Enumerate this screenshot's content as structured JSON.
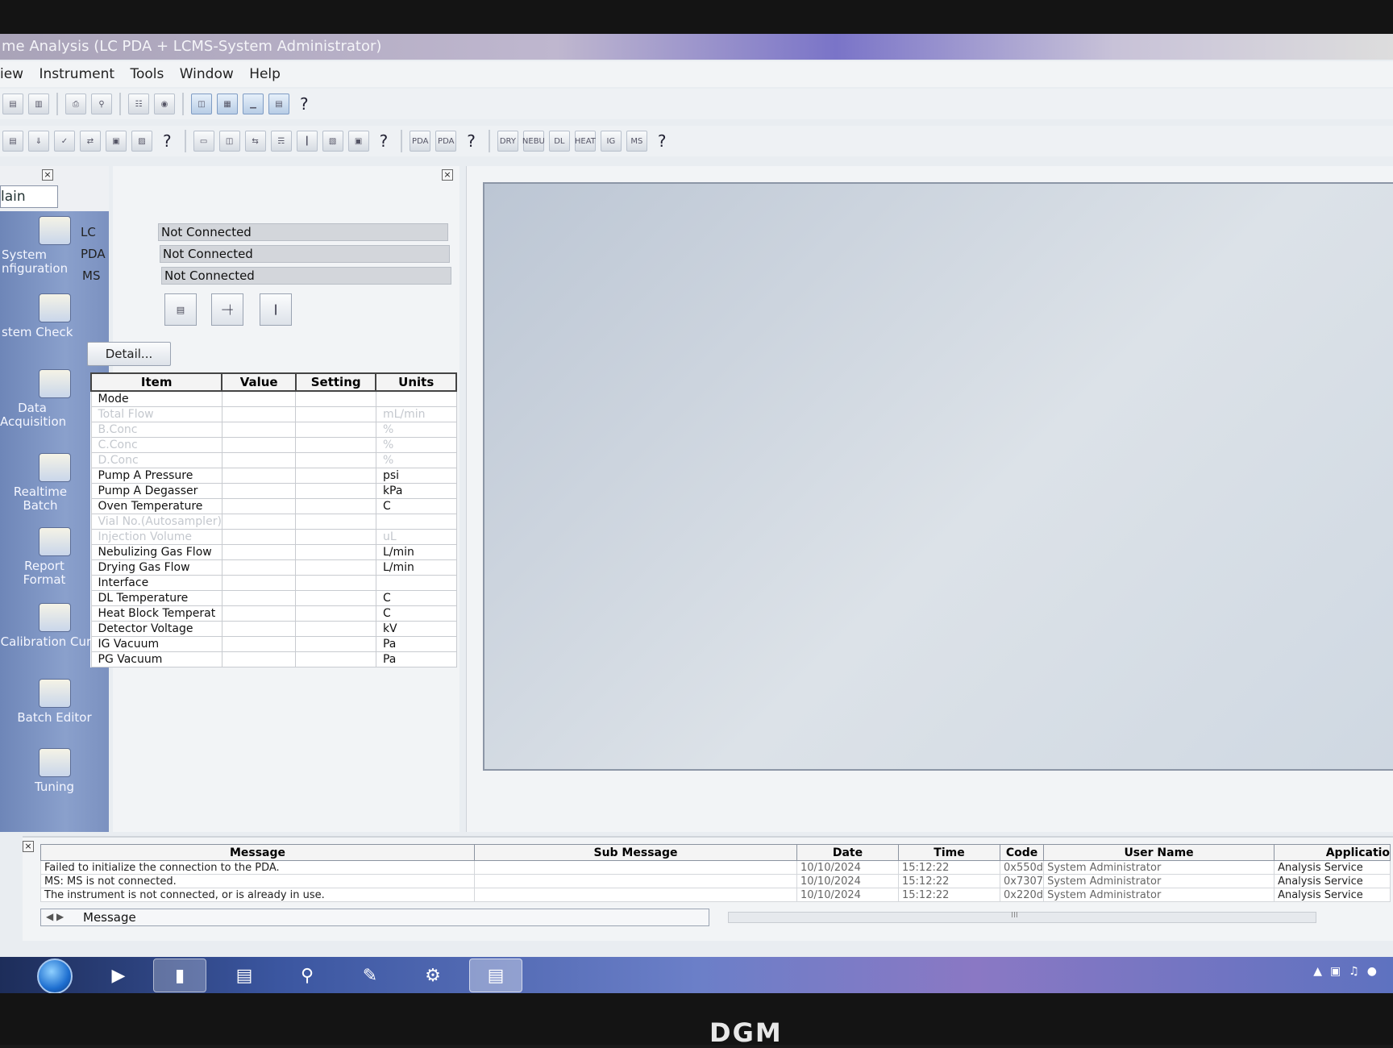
{
  "window": {
    "title": "me Analysis (LC PDA + LCMS-System Administrator)"
  },
  "menu": [
    "iew",
    "Instrument",
    "Tools",
    "Window",
    "Help"
  ],
  "toolbar2_labels": [
    "PDA",
    "PDA",
    "DRY",
    "NEBU",
    "DL",
    "HEAT",
    "IG",
    "MS"
  ],
  "help_glyph": "?",
  "nav": {
    "tab": "lain",
    "items": [
      {
        "label": "System\nnfiguration",
        "icon": "system-configuration-icon"
      },
      {
        "label": "stem Check",
        "icon": "system-check-icon"
      },
      {
        "label": "Data\nAcquisition",
        "icon": "flask-icon"
      },
      {
        "label": "Realtime Batch",
        "icon": "realtime-batch-icon"
      },
      {
        "label": "Report\nFormat",
        "icon": "report-format-icon"
      },
      {
        "label": "Calibration Curve",
        "icon": "calibration-curve-icon"
      },
      {
        "label": "Batch Editor",
        "icon": "batch-editor-icon"
      },
      {
        "label": "Tuning",
        "icon": "tuning-icon"
      }
    ]
  },
  "status": {
    "rows": [
      {
        "label": "LC",
        "value": "Not Connected"
      },
      {
        "label": "PDA",
        "value": "Not Connected"
      },
      {
        "label": "MS",
        "value": "Not Connected"
      }
    ],
    "detail_button": "Detail..."
  },
  "grid": {
    "headers": [
      "Item",
      "Value",
      "Setting",
      "Units"
    ],
    "rows": [
      {
        "item": "Mode",
        "units": "",
        "dim": false
      },
      {
        "item": "Total Flow",
        "units": "mL/min",
        "dim": true
      },
      {
        "item": "B.Conc",
        "units": "%",
        "dim": true
      },
      {
        "item": "C.Conc",
        "units": "%",
        "dim": true
      },
      {
        "item": "D.Conc",
        "units": "%",
        "dim": true
      },
      {
        "item": "Pump A Pressure",
        "units": "psi",
        "dim": false
      },
      {
        "item": "Pump A Degasser",
        "units": "kPa",
        "dim": false
      },
      {
        "item": "Oven Temperature",
        "units": "C",
        "dim": false
      },
      {
        "item": "Vial No.(Autosampler)",
        "units": "",
        "dim": true
      },
      {
        "item": "Injection Volume",
        "units": "uL",
        "dim": true
      },
      {
        "item": "Nebulizing Gas Flow",
        "units": "L/min",
        "dim": false
      },
      {
        "item": "Drying Gas Flow",
        "units": "L/min",
        "dim": false
      },
      {
        "item": "Interface",
        "units": "",
        "dim": false
      },
      {
        "item": "DL Temperature",
        "units": "C",
        "dim": false
      },
      {
        "item": "Heat Block Temperat",
        "units": "C",
        "dim": false
      },
      {
        "item": "Detector Voltage",
        "units": "kV",
        "dim": false
      },
      {
        "item": "IG Vacuum",
        "units": "Pa",
        "dim": false
      },
      {
        "item": "PG Vacuum",
        "units": "Pa",
        "dim": false
      }
    ]
  },
  "messages": {
    "headers": [
      "Message",
      "Sub Message",
      "Date",
      "Time",
      "Code",
      "User Name",
      "Applicatio"
    ],
    "rows": [
      {
        "message": "Failed to initialize the connection to the PDA.",
        "sub": "",
        "date": "10/10/2024",
        "time": "15:12:22",
        "code": "0x550d",
        "user": "System Administrator",
        "app": "Analysis Service"
      },
      {
        "message": "MS: MS is not connected.",
        "sub": "",
        "date": "10/10/2024",
        "time": "15:12:22",
        "code": "0x7307",
        "user": "System Administrator",
        "app": "Analysis Service"
      },
      {
        "message": "The instrument is not connected, or is already in use.",
        "sub": "",
        "date": "10/10/2024",
        "time": "15:12:22",
        "code": "0x220d",
        "user": "System Administrator",
        "app": "Analysis Service"
      }
    ],
    "tab": "Message",
    "scroll_glyph": "III"
  },
  "bezel_brand": "DGM"
}
